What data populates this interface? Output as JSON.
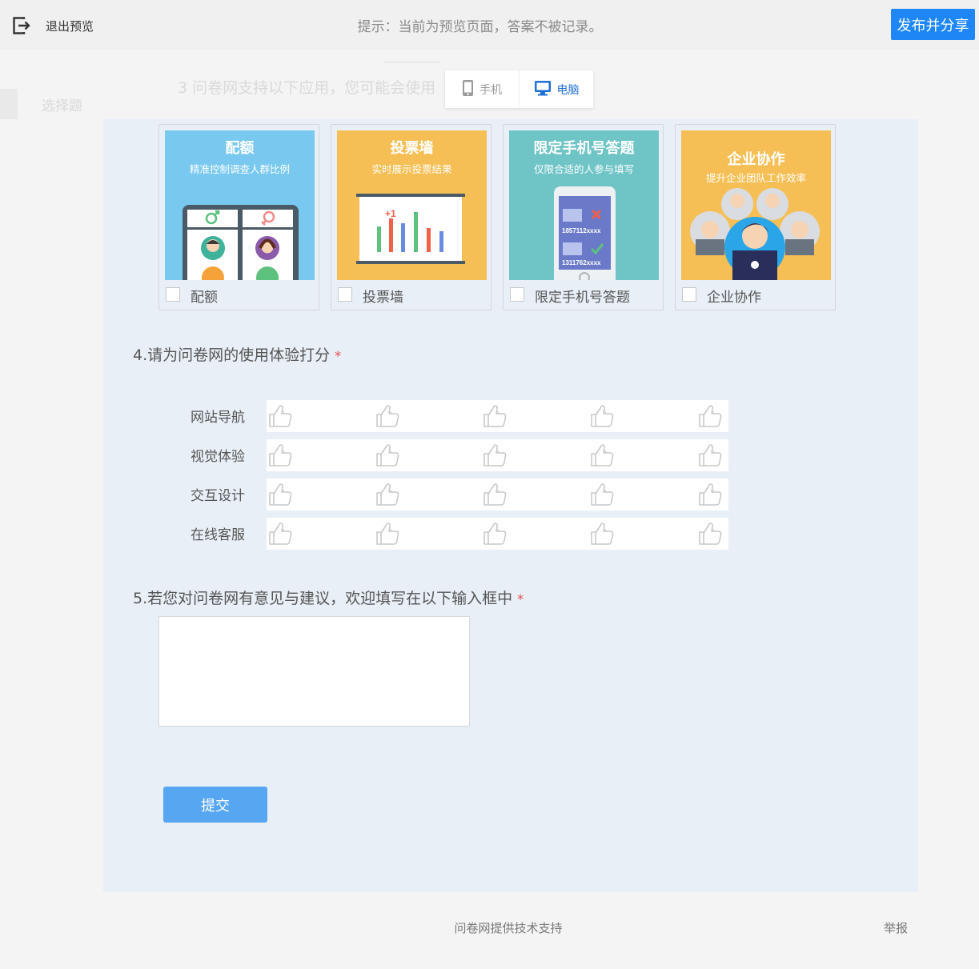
{
  "topbar": {
    "exit_label": "退出预览",
    "hint": "提示：当前为预览页面，答案不被记录。",
    "publish_label": "发布并分享"
  },
  "ghost": {
    "prev_question": "3 问卷网支持以下应用，您可能会使用",
    "side_label": "选择题"
  },
  "device_toggle": {
    "phone_label": "手机",
    "pc_label": "电脑",
    "selected": "电脑"
  },
  "q3": {
    "options": [
      {
        "label": "配额",
        "title": "配额",
        "subtitle": "精准控制调查人群比例",
        "bg": "#78c8ef",
        "checked": false
      },
      {
        "label": "投票墙",
        "title": "投票墙",
        "subtitle": "实时展示投票结果",
        "bg": "#f6bf55",
        "checked": false
      },
      {
        "label": "限定手机号答题",
        "title": "限定手机号答题",
        "subtitle": "仅限合适的人参与填写",
        "bg": "#6fc4c6",
        "checked": false
      },
      {
        "label": "企业协作",
        "title": "企业协作",
        "subtitle": "提升企业团队工作效率",
        "bg": "#f6bf55",
        "checked": false
      }
    ],
    "phone_numbers": [
      "1857112xxxx",
      "1311762xxxx"
    ],
    "vote_plus": "+1"
  },
  "q4": {
    "title": "4.请为问卷网的使用体验打分",
    "required_mark": "*",
    "rows": [
      {
        "label": "网站导航",
        "rating": 0
      },
      {
        "label": "视觉体验",
        "rating": 0
      },
      {
        "label": "交互设计",
        "rating": 0
      },
      {
        "label": "在线客服",
        "rating": 0
      }
    ],
    "scale_max": 5
  },
  "q5": {
    "title": "5.若您对问卷网有意见与建议，欢迎填写在以下输入框中",
    "required_mark": "*",
    "value": ""
  },
  "submit_label": "提交",
  "footer": {
    "tech_support": "问卷网提供技术支持",
    "report": "举报"
  },
  "colors": {
    "accent": "#1f87f5",
    "submit": "#56a6f2",
    "panel_bg": "#e8eff7",
    "required": "#e94b4b"
  }
}
